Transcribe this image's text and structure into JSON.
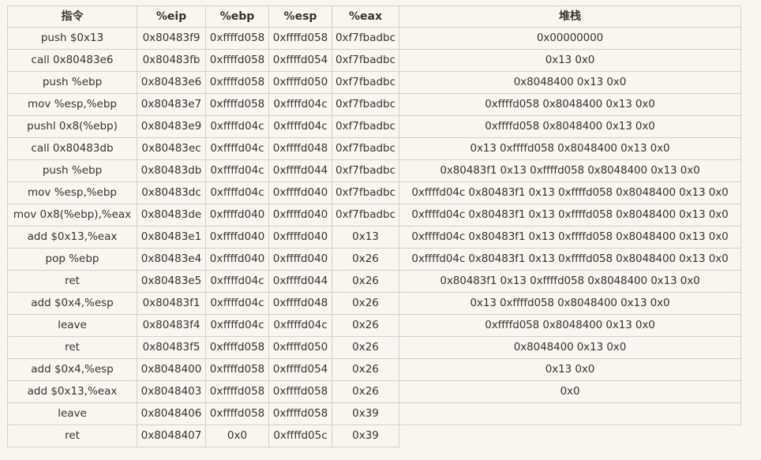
{
  "headers": [
    "指令",
    "%eip",
    "%ebp",
    "%esp",
    "%eax",
    "堆栈"
  ],
  "rows": [
    {
      "instr": "push $0x13",
      "eip": "0x80483f9",
      "ebp": "0xffffd058",
      "esp": "0xffffd058",
      "eax": "0xf7fbadbc",
      "stack": "0x00000000"
    },
    {
      "instr": "call 0x80483e6",
      "eip": "0x80483fb",
      "ebp": "0xffffd058",
      "esp": "0xffffd054",
      "eax": "0xf7fbadbc",
      "stack": "0x13 0x0"
    },
    {
      "instr": "push %ebp",
      "eip": "0x80483e6",
      "ebp": "0xffffd058",
      "esp": "0xffffd050",
      "eax": "0xf7fbadbc",
      "stack": "0x8048400 0x13 0x0"
    },
    {
      "instr": "mov %esp,%ebp",
      "eip": "0x80483e7",
      "ebp": "0xffffd058",
      "esp": "0xffffd04c",
      "eax": "0xf7fbadbc",
      "stack": "0xffffd058 0x8048400 0x13 0x0"
    },
    {
      "instr": "pushl 0x8(%ebp)",
      "eip": "0x80483e9",
      "ebp": "0xffffd04c",
      "esp": "0xffffd04c",
      "eax": "0xf7fbadbc",
      "stack": "0xffffd058 0x8048400 0x13 0x0"
    },
    {
      "instr": "call 0x80483db",
      "eip": "0x80483ec",
      "ebp": "0xffffd04c",
      "esp": "0xffffd048",
      "eax": "0xf7fbadbc",
      "stack": "0x13 0xffffd058 0x8048400 0x13 0x0"
    },
    {
      "instr": "push %ebp",
      "eip": "0x80483db",
      "ebp": "0xffffd04c",
      "esp": "0xffffd044",
      "eax": "0xf7fbadbc",
      "stack": "0x80483f1 0x13 0xffffd058 0x8048400 0x13 0x0"
    },
    {
      "instr": "mov %esp,%ebp",
      "eip": "0x80483dc",
      "ebp": "0xffffd04c",
      "esp": "0xffffd040",
      "eax": "0xf7fbadbc",
      "stack": "0xffffd04c 0x80483f1 0x13 0xffffd058 0x8048400 0x13 0x0"
    },
    {
      "instr": "mov 0x8(%ebp),%eax",
      "eip": "0x80483de",
      "ebp": "0xffffd040",
      "esp": "0xffffd040",
      "eax": "0xf7fbadbc",
      "stack": "0xffffd04c 0x80483f1 0x13 0xffffd058 0x8048400 0x13 0x0"
    },
    {
      "instr": "add $0x13,%eax",
      "eip": "0x80483e1",
      "ebp": "0xffffd040",
      "esp": "0xffffd040",
      "eax": "0x13",
      "stack": "0xffffd04c 0x80483f1 0x13 0xffffd058 0x8048400 0x13 0x0"
    },
    {
      "instr": "pop %ebp",
      "eip": "0x80483e4",
      "ebp": "0xffffd040",
      "esp": "0xffffd040",
      "eax": "0x26",
      "stack": "0xffffd04c 0x80483f1 0x13 0xffffd058 0x8048400 0x13 0x0"
    },
    {
      "instr": "ret",
      "eip": "0x80483e5",
      "ebp": "0xffffd04c",
      "esp": "0xffffd044",
      "eax": "0x26",
      "stack": "0x80483f1 0x13 0xffffd058 0x8048400 0x13 0x0"
    },
    {
      "instr": "add $0x4,%esp",
      "eip": "0x80483f1",
      "ebp": "0xffffd04c",
      "esp": "0xffffd048",
      "eax": "0x26",
      "stack": "0x13 0xffffd058 0x8048400 0x13 0x0"
    },
    {
      "instr": "leave",
      "eip": "0x80483f4",
      "ebp": "0xffffd04c",
      "esp": "0xffffd04c",
      "eax": "0x26",
      "stack": "0xffffd058 0x8048400 0x13 0x0"
    },
    {
      "instr": "ret",
      "eip": "0x80483f5",
      "ebp": "0xffffd058",
      "esp": "0xffffd050",
      "eax": "0x26",
      "stack": "0x8048400 0x13 0x0"
    },
    {
      "instr": "add $0x4,%esp",
      "eip": "0x8048400",
      "ebp": "0xffffd058",
      "esp": "0xffffd054",
      "eax": "0x26",
      "stack": "0x13 0x0"
    },
    {
      "instr": "add $0x13,%eax",
      "eip": "0x8048403",
      "ebp": "0xffffd058",
      "esp": "0xffffd058",
      "eax": "0x26",
      "stack": "0x0"
    },
    {
      "instr": "leave",
      "eip": "0x8048406",
      "ebp": "0xffffd058",
      "esp": "0xffffd058",
      "eax": "0x39",
      "stack": ""
    },
    {
      "instr": "ret",
      "eip": "0x8048407",
      "ebp": "0x0",
      "esp": "0xffffd05c",
      "eax": "0x39",
      "stack": null
    }
  ]
}
